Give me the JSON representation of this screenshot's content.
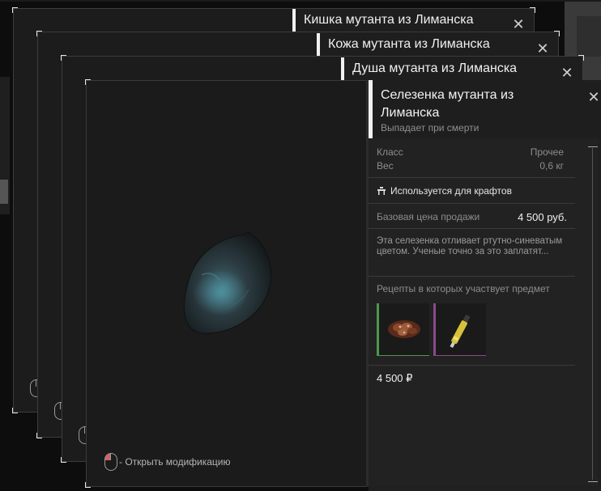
{
  "stack_cards": [
    {
      "title": "Кишка мутанта из Лиманска"
    },
    {
      "title": "Кожа мутанта из Лиманска"
    },
    {
      "title": "Душа мутанта из Лиманска"
    }
  ],
  "item": {
    "title": "Селезенка мутанта из Лиманска",
    "subtitle": "Выпадает при смерти",
    "class_label": "Класс",
    "class_value": "Прочее",
    "weight_label": "Вес",
    "weight_value": "0,6 кг",
    "craft_note": "Используется для крафтов",
    "price_label": "Базовая цена продажи",
    "price_value": "4 500 руб.",
    "description": "Эта селезенка отливает ртутно-синеватым цветом. Ученые точно за это заплатят...",
    "recipes_label": "Рецепты в которых участвует предмет",
    "total_price": "4 500 ₽"
  },
  "preview": {
    "hint": "- Открыть модификацию"
  },
  "icons": {
    "close": "close-icon",
    "mouse": "mouse-icon",
    "craft": "workbench-icon"
  },
  "colors": {
    "accent": "#f0f0f0",
    "recipe_green": "#4a9a4a",
    "recipe_purple": "#8a4a8a"
  }
}
